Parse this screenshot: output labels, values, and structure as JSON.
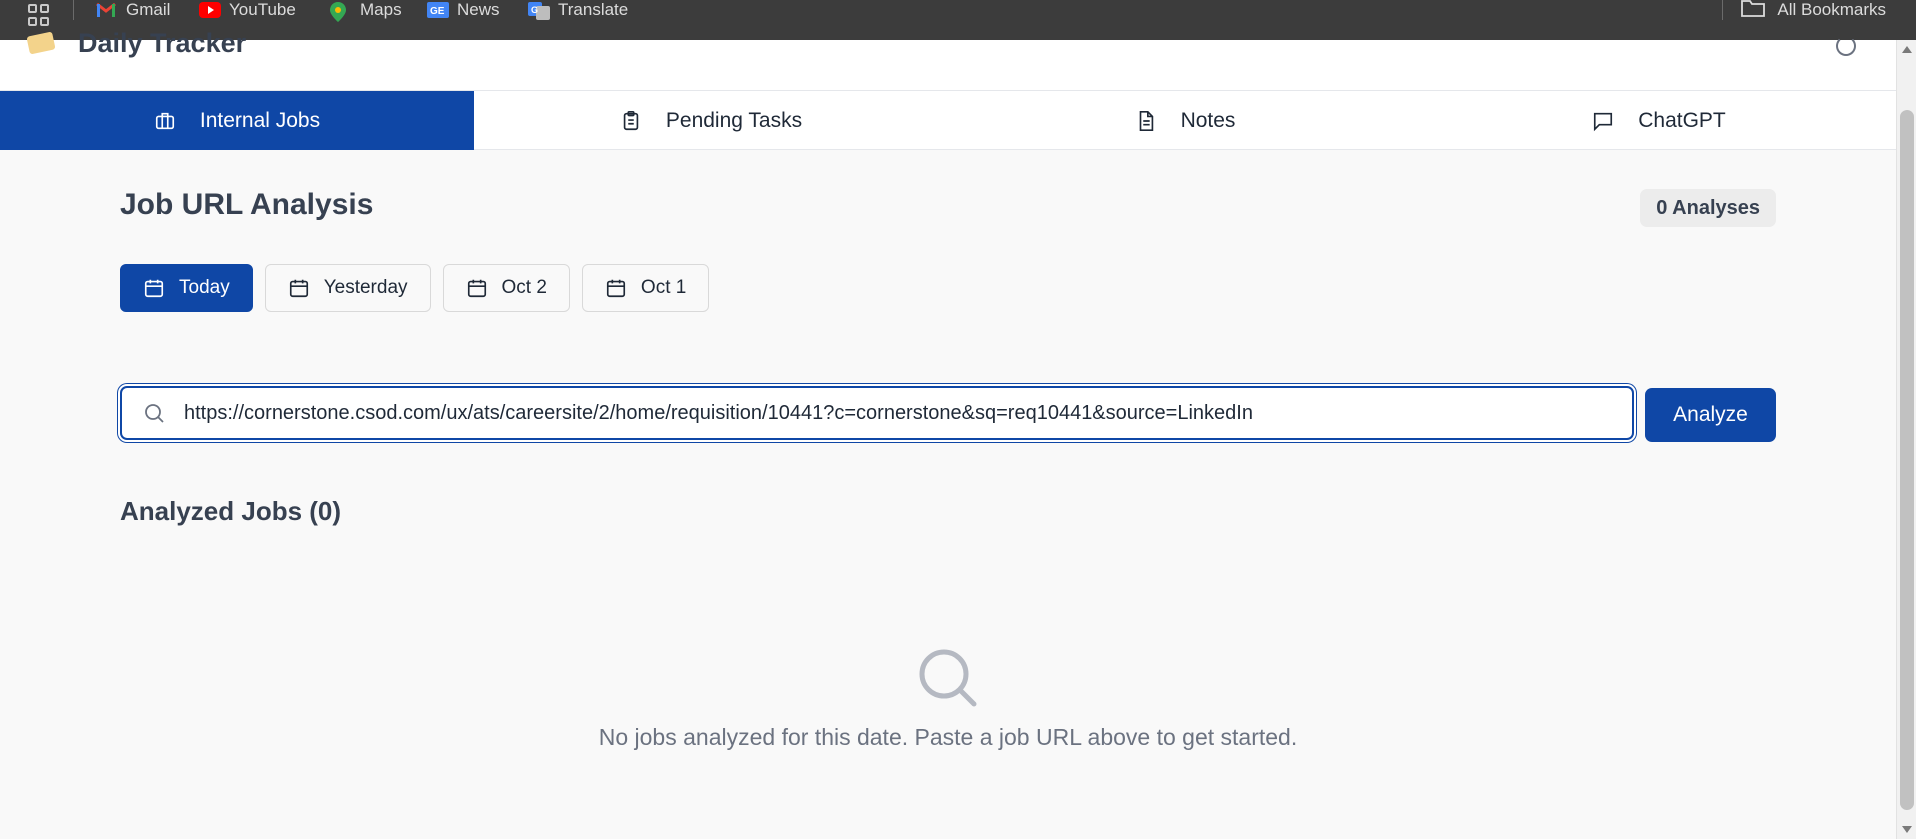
{
  "bookmarks_bar": {
    "items": [
      {
        "label": "Gmail",
        "icon": "gmail-icon",
        "color": "#ea4335"
      },
      {
        "label": "YouTube",
        "icon": "youtube-icon",
        "color": "#ff0000"
      },
      {
        "label": "Maps",
        "icon": "maps-icon",
        "color": "#34a853"
      },
      {
        "label": "News",
        "icon": "news-icon",
        "color": "#4285f4"
      },
      {
        "label": "Translate",
        "icon": "translate-icon",
        "color": "#4285f4"
      }
    ],
    "all_bookmarks": "All Bookmarks"
  },
  "app": {
    "title": "Daily Tracker"
  },
  "tabs": [
    {
      "label": "Internal Jobs",
      "icon": "briefcase-icon",
      "active": true
    },
    {
      "label": "Pending Tasks",
      "icon": "clipboard-icon",
      "active": false
    },
    {
      "label": "Notes",
      "icon": "document-icon",
      "active": false
    },
    {
      "label": "ChatGPT",
      "icon": "chat-icon",
      "active": false
    }
  ],
  "main": {
    "heading": "Job URL Analysis",
    "badge": "0 Analyses",
    "date_buttons": [
      {
        "label": "Today",
        "active": true
      },
      {
        "label": "Yesterday",
        "active": false
      },
      {
        "label": "Oct 2",
        "active": false
      },
      {
        "label": "Oct 1",
        "active": false
      }
    ],
    "url_input": {
      "value": "https://cornerstone.csod.com/ux/ats/careersite/2/home/requisition/10441?c=cornerstone&sq=req10441&source=LinkedIn"
    },
    "analyze_label": "Analyze",
    "analyzed_heading": "Analyzed Jobs (0)",
    "empty_message": "No jobs analyzed for this date. Paste a job URL above to get started."
  },
  "colors": {
    "primary": "#0f47a6",
    "bookmarks_bg": "#3c3c3c"
  }
}
